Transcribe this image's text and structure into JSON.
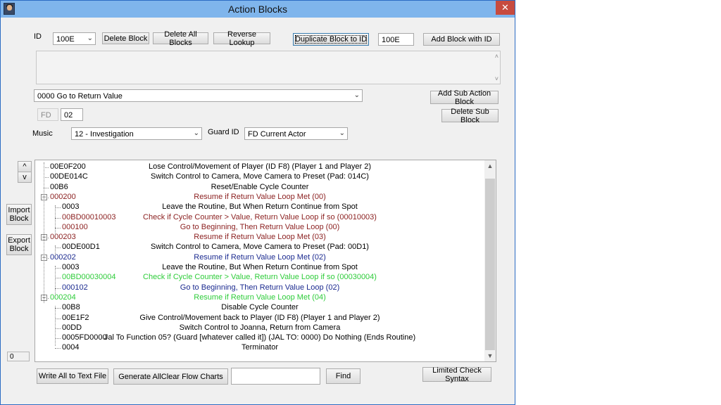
{
  "window": {
    "title": "Action Blocks",
    "close_glyph": "✕"
  },
  "toolbar": {
    "id_label": "ID",
    "id_value": "100E",
    "delete_block": "Delete Block",
    "delete_all_blocks": "Delete All Blocks",
    "reverse_lookup": "Reverse Lookup",
    "duplicate_block": "Duplicate Block to ID",
    "duplicate_target": "100E",
    "add_block_with_id": "Add Block with ID"
  },
  "sub_action": {
    "selected": "0000 Go to Return Value",
    "add_sub_action_block": "Add Sub Action Block",
    "delete_sub_block": "Delete Sub Block",
    "fd_label": "FD",
    "fd_value": "02"
  },
  "music": {
    "label": "Music",
    "value": "12 - Investigation"
  },
  "guard": {
    "label": "Guard ID",
    "value": "FD Current Actor"
  },
  "side": {
    "up": "^",
    "down": "v",
    "import_line1": "Import",
    "import_line2": "Block",
    "export_line1": "Export",
    "export_line2": "Block",
    "counter": "0"
  },
  "tree": {
    "rows": [
      {
        "code": "00E0F200",
        "desc": "Lose Control/Movement of Player (ID F8) (Player 1 and Player 2)",
        "color": "black",
        "level": 0
      },
      {
        "code": "00DE014C",
        "desc": "Switch Control to Camera, Move Camera to Preset (Pad: 014C)",
        "color": "black",
        "level": 0
      },
      {
        "code": "00B6",
        "desc": "Reset/Enable Cycle Counter",
        "color": "black",
        "level": 0
      },
      {
        "code": "000200",
        "desc": "Resume if Return Value Loop Met (00)",
        "color": "red",
        "level": 0,
        "expander": "−"
      },
      {
        "code": "0003",
        "desc": "Leave the Routine, But When Return Continue from Spot",
        "color": "black",
        "level": 1
      },
      {
        "code": "00BD00010003",
        "desc": "Check if Cycle Counter > Value, Return Value Loop if so (00010003)",
        "color": "red",
        "level": 1
      },
      {
        "code": "000100",
        "desc": "Go to Beginning, Then Return Value Loop (00)",
        "color": "red",
        "level": 1
      },
      {
        "code": "000203",
        "desc": "Resume if Return Value Loop Met (03)",
        "color": "red",
        "level": 0,
        "expander": "−"
      },
      {
        "code": "00DE00D1",
        "desc": "Switch Control to Camera, Move Camera to Preset (Pad: 00D1)",
        "color": "black",
        "level": 1
      },
      {
        "code": "000202",
        "desc": "Resume if Return Value Loop Met (02)",
        "color": "blue",
        "level": 0,
        "expander": "−"
      },
      {
        "code": "0003",
        "desc": "Leave the Routine, But When Return Continue from Spot",
        "color": "black",
        "level": 1
      },
      {
        "code": "00BD00030004",
        "desc": "Check if Cycle Counter > Value, Return Value Loop if so (00030004)",
        "color": "green",
        "level": 1
      },
      {
        "code": "000102",
        "desc": "Go to Beginning, Then Return Value Loop (02)",
        "color": "blue",
        "level": 1
      },
      {
        "code": "000204",
        "desc": "Resume if Return Value Loop Met (04)",
        "color": "green",
        "level": 0,
        "expander": "−"
      },
      {
        "code": "00B8",
        "desc": "Disable Cycle Counter",
        "color": "black",
        "level": 1
      },
      {
        "code": "00E1F2",
        "desc": "Give Control/Movement back to Player (ID F8) (Player 1 and Player 2)",
        "color": "black",
        "level": 1
      },
      {
        "code": "00DD",
        "desc": "Switch Control to Joanna, Return from Camera",
        "color": "black",
        "level": 1
      },
      {
        "code": "0005FD0000",
        "desc": "Jal To Function 05? (Guard [whatever called it]) (JAL TO: 0000) Do Nothing (Ends Routine)",
        "color": "black",
        "level": 1
      },
      {
        "code": "0004",
        "desc": "Terminator",
        "color": "black",
        "level": 1
      }
    ]
  },
  "bottom": {
    "write_all": "Write All to Text File",
    "generate": "Generate AllClear Flow Charts",
    "search_value": "",
    "find": "Find",
    "limited_check": "Limited Check Syntax"
  },
  "colors": {
    "red": "#8a1e1e",
    "blue": "#1b2a8f",
    "green": "#2ecc3a",
    "titlebar": "#7fb5ec",
    "close": "#c74b3f"
  }
}
